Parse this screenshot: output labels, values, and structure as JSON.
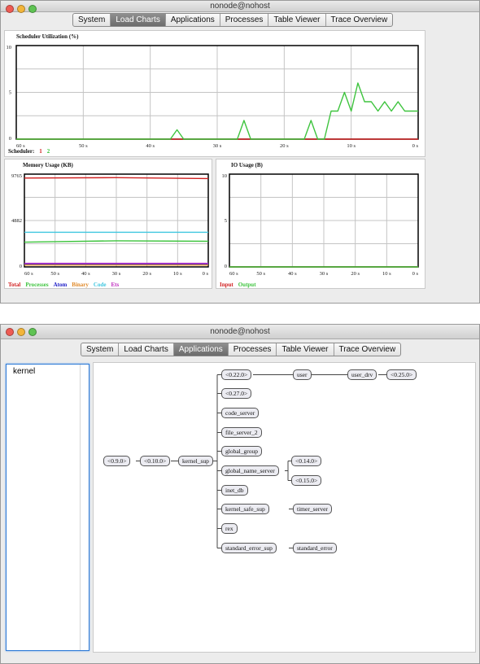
{
  "window1": {
    "title": "nonode@nohost",
    "tabs": [
      {
        "label": "System",
        "active": false
      },
      {
        "label": "Load Charts",
        "active": true
      },
      {
        "label": "Applications",
        "active": false
      },
      {
        "label": "Processes",
        "active": false
      },
      {
        "label": "Table Viewer",
        "active": false
      },
      {
        "label": "Trace Overview",
        "active": false
      }
    ]
  },
  "window2": {
    "title": "nonode@nohost",
    "tabs": [
      {
        "label": "System",
        "active": false
      },
      {
        "label": "Load Charts",
        "active": false
      },
      {
        "label": "Applications",
        "active": true
      },
      {
        "label": "Processes",
        "active": false
      },
      {
        "label": "Table Viewer",
        "active": false
      },
      {
        "label": "Trace Overview",
        "active": false
      }
    ],
    "sidebar": {
      "items": [
        "kernel"
      ]
    },
    "tree": {
      "nodes": [
        "<0.9.0>",
        "<0.10.0>",
        "kernel_sup",
        "<0.22.0>",
        "user",
        "user_drv",
        "<0.25.0>",
        "<0.27.0>",
        "code_server",
        "file_server_2",
        "global_group",
        "global_name_server",
        "<0.14.0>",
        "<0.15.0>",
        "inet_db",
        "kernel_safe_sup",
        "timer_server",
        "rex",
        "standard_error_sup",
        "standard_error"
      ]
    }
  },
  "colors": {
    "red": "#d02020",
    "green": "#3ec43e",
    "blue": "#2020c8",
    "orange": "#e08a2a",
    "cyan": "#3fc7e0",
    "magenta": "#c030c0"
  },
  "chart_data": [
    {
      "type": "line",
      "title": "Scheduler Utilization (%)",
      "x_ticks": [
        "60 s",
        "50 s",
        "40 s",
        "30 s",
        "20 s",
        "10 s",
        "0 s"
      ],
      "y_ticks": [
        "10",
        "5",
        "0"
      ],
      "ylim": [
        0,
        10
      ],
      "legend_label": "Scheduler:",
      "series": [
        {
          "name": "1",
          "color": "#d02020",
          "x": [
            60,
            0
          ],
          "y": [
            0,
            0
          ]
        },
        {
          "name": "2",
          "color": "#3ec43e",
          "x": [
            60,
            37,
            36,
            35,
            34,
            27,
            26,
            25,
            24,
            17,
            16,
            15,
            14,
            13,
            12,
            11,
            10,
            9,
            8,
            7,
            6,
            5,
            4,
            3,
            2,
            1,
            0
          ],
          "y": [
            0,
            0,
            1,
            0,
            0,
            0,
            2,
            0,
            0,
            0,
            2,
            0,
            0,
            3,
            3,
            5,
            3,
            6,
            4,
            4,
            3,
            4,
            3,
            4,
            3,
            3,
            3
          ]
        }
      ]
    },
    {
      "type": "line",
      "title": "Memory Usage (KB)",
      "x_ticks": [
        "60 s",
        "50 s",
        "40 s",
        "30 s",
        "20 s",
        "10 s",
        "0 s"
      ],
      "y_ticks": [
        "9765",
        "4882",
        "0"
      ],
      "ylim": [
        0,
        9765
      ],
      "series": [
        {
          "name": "Total",
          "color": "#d02020",
          "x": [
            60,
            30,
            0
          ],
          "y": [
            9350,
            9400,
            9300
          ]
        },
        {
          "name": "Processes",
          "color": "#3ec43e",
          "x": [
            60,
            30,
            0
          ],
          "y": [
            2600,
            2750,
            2700
          ]
        },
        {
          "name": "Atom",
          "color": "#2020c8",
          "x": [
            60,
            0
          ],
          "y": [
            270,
            270
          ]
        },
        {
          "name": "Binary",
          "color": "#e08a2a",
          "x": [
            60,
            0
          ],
          "y": [
            200,
            200
          ]
        },
        {
          "name": "Code",
          "color": "#3fc7e0",
          "x": [
            60,
            0
          ],
          "y": [
            3650,
            3650
          ]
        },
        {
          "name": "Ets",
          "color": "#c030c0",
          "x": [
            60,
            0
          ],
          "y": [
            380,
            380
          ]
        }
      ]
    },
    {
      "type": "line",
      "title": "IO Usage (B)",
      "x_ticks": [
        "60 s",
        "50 s",
        "40 s",
        "30 s",
        "20 s",
        "10 s",
        "0 s"
      ],
      "y_ticks": [
        "10",
        "5",
        "0"
      ],
      "ylim": [
        0,
        10
      ],
      "series": [
        {
          "name": "Input",
          "color": "#d02020",
          "x": [
            60,
            0
          ],
          "y": [
            0,
            0
          ]
        },
        {
          "name": "Output",
          "color": "#3ec43e",
          "x": [
            60,
            0
          ],
          "y": [
            0,
            0
          ]
        }
      ]
    }
  ]
}
